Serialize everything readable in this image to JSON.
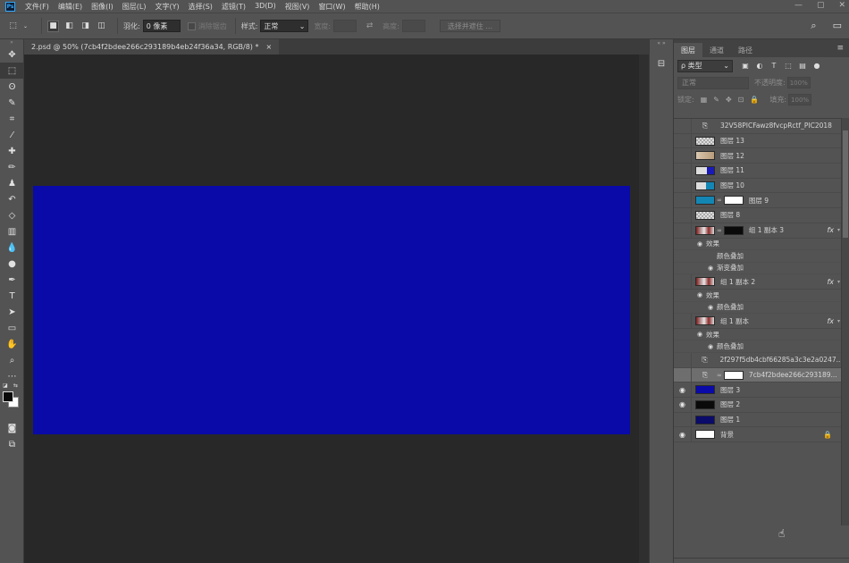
{
  "app": {
    "logo": "Ps"
  },
  "menu": [
    "文件(F)",
    "编辑(E)",
    "图像(I)",
    "图层(L)",
    "文字(Y)",
    "选择(S)",
    "滤镜(T)",
    "3D(D)",
    "视图(V)",
    "窗口(W)",
    "帮助(H)"
  ],
  "window_controls": [
    "—",
    "▢",
    "✕"
  ],
  "options": {
    "feather_label": "羽化:",
    "feather_value": "0 像素",
    "antialias_label": "消除锯齿",
    "style_label": "样式:",
    "style_value": "正常",
    "width_label": "宽度:",
    "height_label": "高度:",
    "select_mask_button": "选择并遮住 ..."
  },
  "document": {
    "tab_title": "2.psd @ 50% (7cb4f2bdee266c293189b4eb24f36a34, RGB/8) *",
    "close": "×",
    "canvas_color": "#0a0aa8"
  },
  "panel": {
    "tabs": [
      "图层",
      "通道",
      "路径"
    ],
    "kind_label": "ρ 类型",
    "blend_mode": "正常",
    "opacity_label": "不透明度:",
    "opacity_value": "100%",
    "lock_label": "锁定:",
    "fill_label": "填充:",
    "fill_value": "100%"
  },
  "layers": [
    {
      "kind": "layer",
      "name": "32V58PICFawz8fvcpRctf_PIC2018",
      "visible": false,
      "thumb": "smart",
      "mask": false
    },
    {
      "kind": "layer",
      "name": "图层 13",
      "visible": false,
      "thumb": "checker",
      "mask": false
    },
    {
      "kind": "layer",
      "name": "图层 12",
      "visible": false,
      "thumb": "tan",
      "mask": false
    },
    {
      "kind": "layer",
      "name": "图层 11",
      "visible": false,
      "thumb": "checker-blue",
      "mask": false
    },
    {
      "kind": "layer",
      "name": "图层 10",
      "visible": false,
      "thumb": "checker-teal",
      "mask": false
    },
    {
      "kind": "layer",
      "name": "图层 9",
      "visible": false,
      "thumb": "teal",
      "mask": true,
      "mask_color": "#ffffff"
    },
    {
      "kind": "layer",
      "name": "图层 8",
      "visible": false,
      "thumb": "checker",
      "mask": false
    },
    {
      "kind": "layer",
      "name": "组 1 副本 3",
      "visible": false,
      "thumb": "photo",
      "mask": true,
      "mask_color": "#0a0a0a",
      "fx": "fx"
    },
    {
      "kind": "sub",
      "name": "效果",
      "indent": 36,
      "eye": true
    },
    {
      "kind": "sub",
      "name": "颜色叠加",
      "indent": 48,
      "eye": false
    },
    {
      "kind": "sub",
      "name": "渐变叠加",
      "indent": 48,
      "eye": true
    },
    {
      "kind": "layer",
      "name": "组 1 副本 2",
      "visible": false,
      "thumb": "photo",
      "mask": false,
      "fx": "fx"
    },
    {
      "kind": "sub",
      "name": "效果",
      "indent": 36,
      "eye": true
    },
    {
      "kind": "sub",
      "name": "颜色叠加",
      "indent": 48,
      "eye": true
    },
    {
      "kind": "layer",
      "name": "组 1 副本",
      "visible": false,
      "thumb": "photo",
      "mask": false,
      "fx": "fx"
    },
    {
      "kind": "sub",
      "name": "效果",
      "indent": 36,
      "eye": true
    },
    {
      "kind": "sub",
      "name": "颜色叠加",
      "indent": 48,
      "eye": true
    },
    {
      "kind": "layer",
      "name": "2f297f5db4cbf66285a3c3e2a0247...",
      "visible": false,
      "thumb": "smart",
      "mask": false
    },
    {
      "kind": "layer",
      "name": "7cb4f2bdee266c293189...",
      "visible": false,
      "thumb": "smart",
      "mask": true,
      "mask_color": "#ffffff",
      "selected": true
    },
    {
      "kind": "layer",
      "name": "图层 3",
      "visible": true,
      "thumb": "blue",
      "mask": false
    },
    {
      "kind": "layer",
      "name": "图层 2",
      "visible": true,
      "thumb": "black",
      "mask": false
    },
    {
      "kind": "layer",
      "name": "图层 1",
      "visible": false,
      "thumb": "navy",
      "mask": false
    },
    {
      "kind": "layer",
      "name": "背景",
      "visible": true,
      "thumb": "white",
      "mask": false,
      "locked": true
    }
  ],
  "fx_arrow": "▾",
  "lock_icon": "🔒",
  "eye_icon": "👁"
}
